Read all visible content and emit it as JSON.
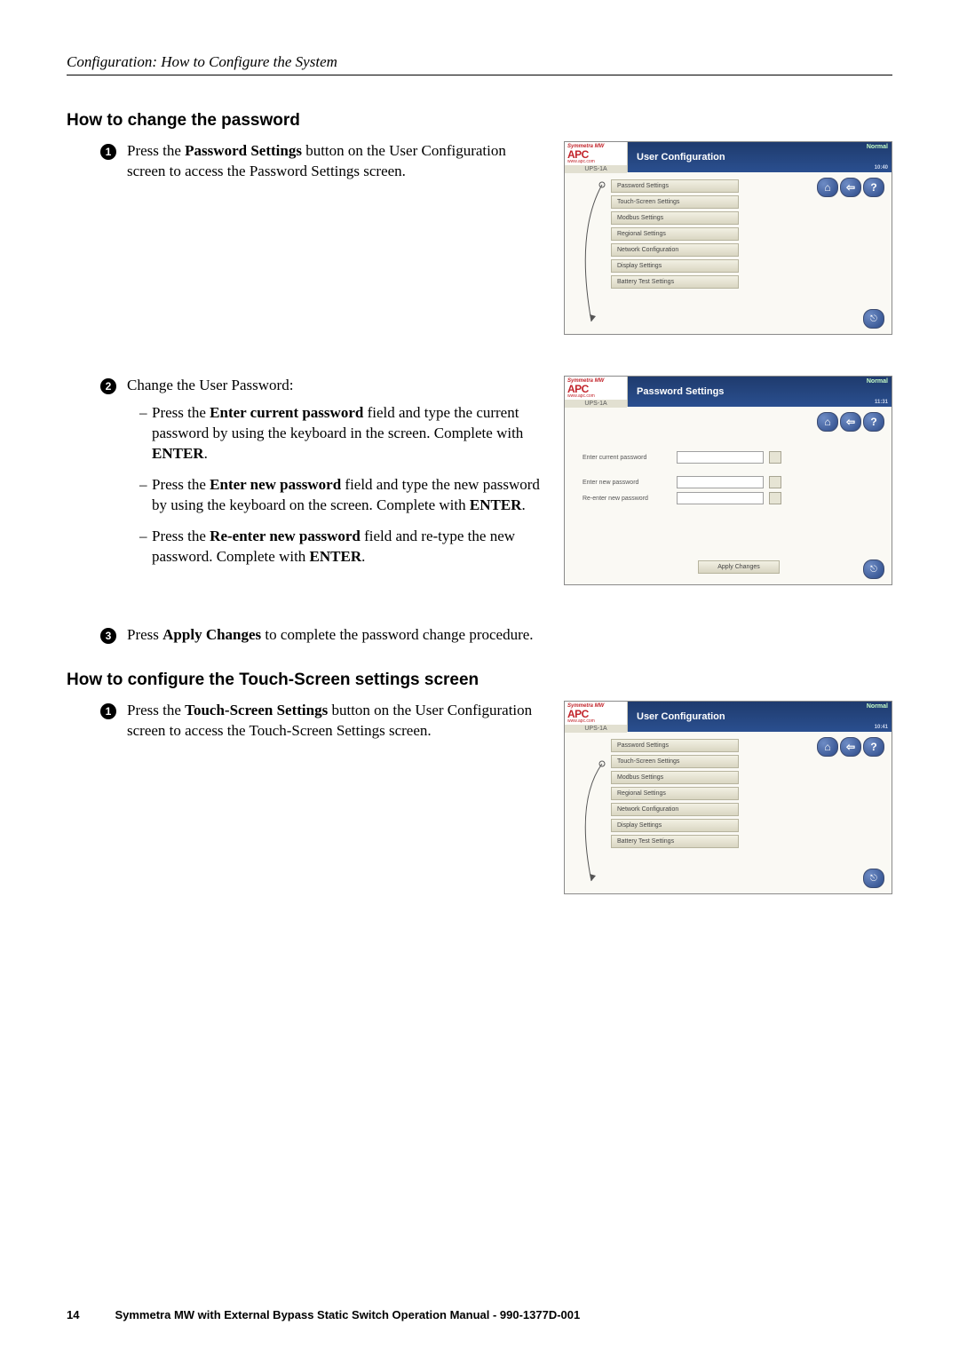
{
  "breadcrumb": "Configuration: How to Configure the System",
  "section1": {
    "title": "How to change the password",
    "step1_text_a": "Press the ",
    "step1_text_b": "Password Settings",
    "step1_text_c": " button on the User Configuration screen to access the Password Settings screen.",
    "step2_intro": "Change the User Password:",
    "bullets": {
      "b1_a": "Press the ",
      "b1_b": "Enter current password",
      "b1_c": " field and type the current password by using the keyboard in the screen. Complete with ",
      "b1_d": "ENTER",
      "b1_e": ".",
      "b2_a": "Press the ",
      "b2_b": "Enter new password",
      "b2_c": " field and type the new password by using the keyboard on the screen. Complete with ",
      "b2_d": "ENTER",
      "b2_e": ".",
      "b3_a": "Press the ",
      "b3_b": "Re-enter new password",
      "b3_c": " field and re-type the new password. Complete with ",
      "b3_d": "ENTER",
      "b3_e": "."
    },
    "step3_a": "Press ",
    "step3_b": "Apply Changes",
    "step3_c": " to complete the password change procedure."
  },
  "section2": {
    "title": "How to configure the Touch-Screen settings screen",
    "step1_a": "Press the ",
    "step1_b": "Touch-Screen Settings",
    "step1_c": " button on the User Configuration screen to access the Touch-Screen Settings screen."
  },
  "screen": {
    "product": "Symmetra MW",
    "brand": "APC",
    "url": "www.apc.com",
    "unit": "UPS-1A",
    "status": "Normal",
    "time1": "10:40",
    "time2": "11:31",
    "time3": "10:41",
    "title_user_config": "User Configuration",
    "title_password": "Password Settings",
    "menu": {
      "m1": "Password Settings",
      "m2": "Touch-Screen Settings",
      "m3": "Modbus Settings",
      "m4": "Regional Settings",
      "m5": "Network Configuration",
      "m6": "Display Settings",
      "m7": "Battery Test Settings"
    },
    "pw_labels": {
      "l1": "Enter current password",
      "l2": "Enter new password",
      "l3": "Re-enter new password"
    },
    "apply": "Apply Changes"
  },
  "footer": {
    "page": "14",
    "text": "Symmetra MW with External Bypass Static Switch Operation Manual - 990-1377D-001"
  }
}
